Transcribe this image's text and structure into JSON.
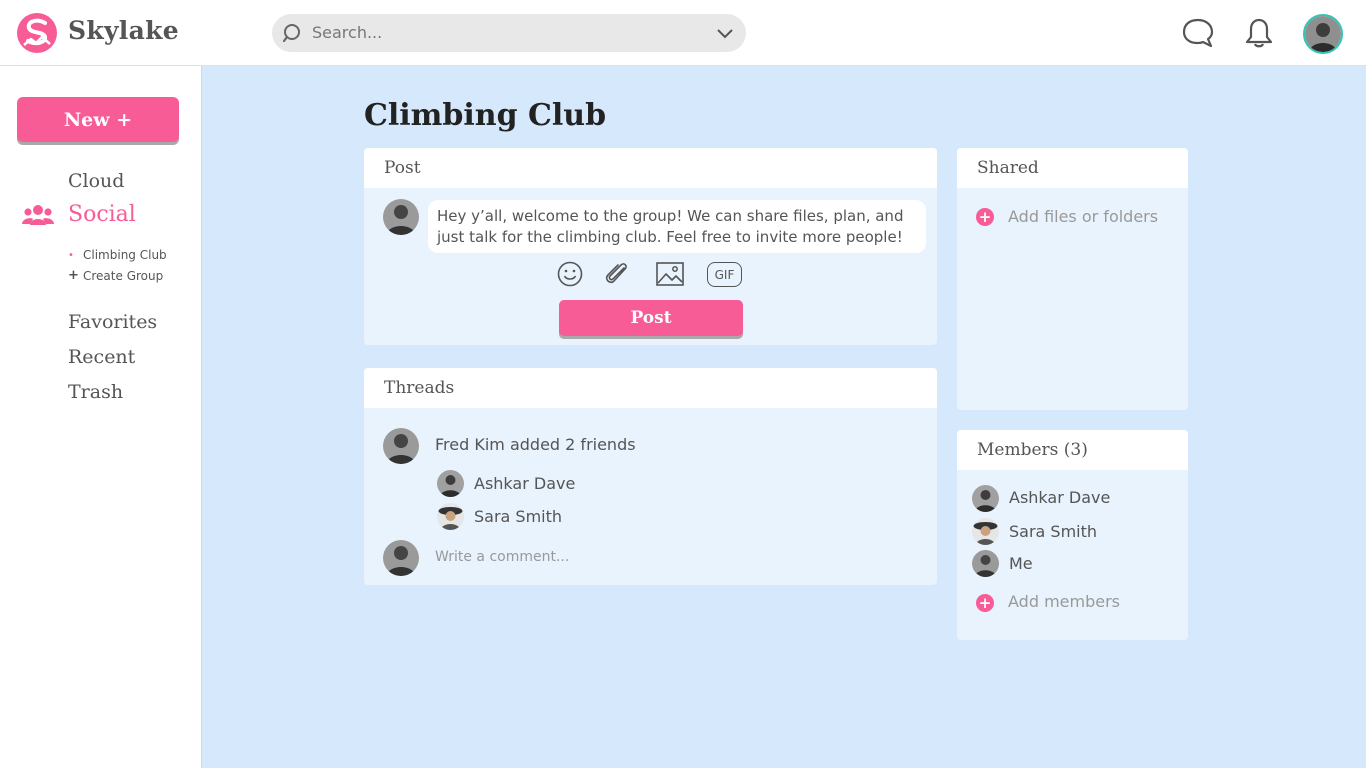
{
  "app": {
    "name": "Skylake"
  },
  "search": {
    "placeholder": "Search..."
  },
  "sidebar": {
    "new_label": "New +",
    "items": [
      {
        "label": "Cloud"
      },
      {
        "label": "Social",
        "active": true
      },
      {
        "label": "Favorites"
      },
      {
        "label": "Recent"
      },
      {
        "label": "Trash"
      }
    ],
    "social_sub": [
      {
        "label": "Climbing Club",
        "marker": "•"
      },
      {
        "label": "Create Group",
        "marker": "+"
      }
    ]
  },
  "page": {
    "title": "Climbing Club"
  },
  "post_panel": {
    "header": "Post",
    "message": "Hey y’all, welcome to the group! We can share files, plan, and just talk for the climbing club. Feel free to invite more people!",
    "gif_label": "GIF",
    "post_button": "Post"
  },
  "threads_panel": {
    "header": "Threads",
    "activity": "Fred Kim added 2 friends",
    "added": [
      "Ashkar Dave",
      "Sara Smith"
    ],
    "comment_placeholder": "Write a comment..."
  },
  "shared_panel": {
    "header": "Shared",
    "add_label": "Add files or folders"
  },
  "members_panel": {
    "header": "Members (3)",
    "members": [
      "Ashkar Dave",
      "Sara Smith",
      "Me"
    ],
    "add_label": "Add members"
  },
  "colors": {
    "accent": "#f75c96",
    "background": "#d6e8fc",
    "panel": "#e9f3fd",
    "avatar_ring": "#2ec4b6"
  }
}
